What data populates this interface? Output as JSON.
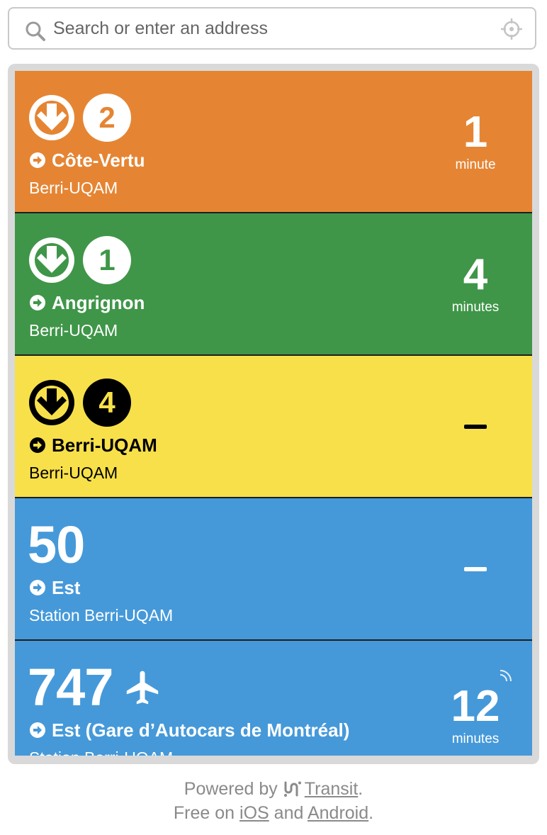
{
  "search": {
    "placeholder": "Search or enter an address",
    "value": ""
  },
  "departures": [
    {
      "type": "metro",
      "line_number": "2",
      "bg_color": "#E58533",
      "fg_color": "#FFFFFF",
      "badge_text_color": "#E58533",
      "direction": "Côte-Vertu",
      "stop": "Berri-UQAM",
      "eta_value": "1",
      "eta_unit": "minute"
    },
    {
      "type": "metro",
      "line_number": "1",
      "bg_color": "#3F9648",
      "fg_color": "#FFFFFF",
      "badge_text_color": "#3F9648",
      "direction": "Angrignon",
      "stop": "Berri-UQAM",
      "eta_value": "4",
      "eta_unit": "minutes"
    },
    {
      "type": "metro",
      "line_number": "4",
      "bg_color": "#F8E04A",
      "fg_color": "#000000",
      "badge_text_color": "#F8E04A",
      "direction": "Berri-UQAM",
      "stop": "Berri-UQAM",
      "eta_value": "–",
      "eta_unit": ""
    },
    {
      "type": "bus",
      "route": "50",
      "bg_color": "#4599D9",
      "fg_color": "#FFFFFF",
      "direction": "Est",
      "stop": "Station Berri-UQAM",
      "eta_value": "–",
      "eta_unit": ""
    },
    {
      "type": "bus",
      "route": "747",
      "route_icon": "airplane-icon",
      "bg_color": "#4599D9",
      "fg_color": "#FFFFFF",
      "direction": "Est (Gare d’Autocars de Montréal)",
      "stop": "Station Berri-UQAM",
      "eta_value": "12",
      "eta_unit": "minutes",
      "realtime": true
    }
  ],
  "footer": {
    "powered_prefix": "Powered by",
    "transit_link": "Transit",
    "powered_suffix": ".",
    "free_prefix": "Free on",
    "ios_link": "iOS",
    "and_text": "and",
    "android_link": "Android",
    "free_suffix": "."
  }
}
